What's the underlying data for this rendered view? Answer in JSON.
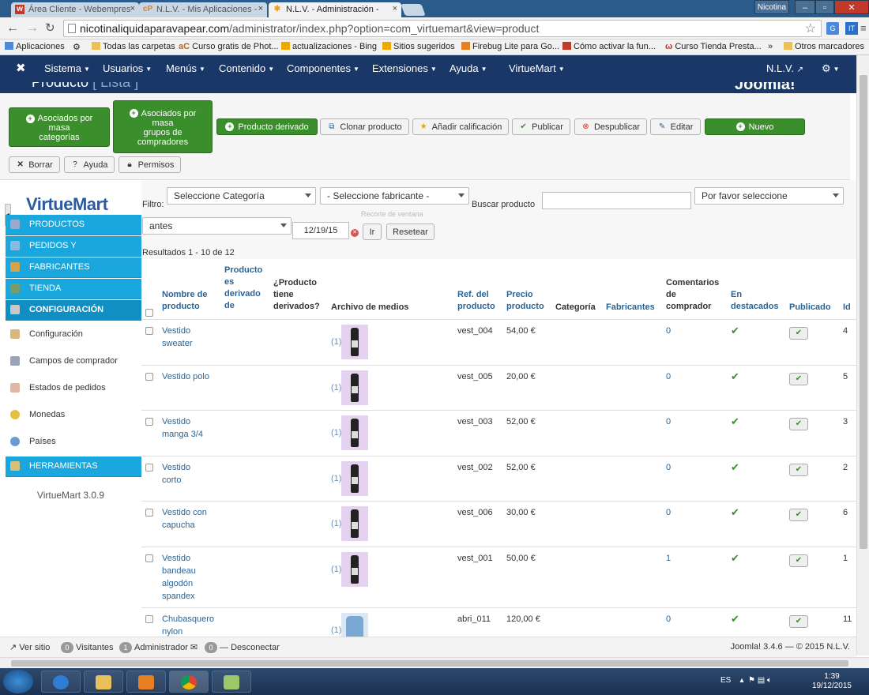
{
  "browser": {
    "tabs": [
      {
        "label": "Área Cliente - Webempres",
        "active": false
      },
      {
        "label": "N.L.V. - Mis Aplicaciones -",
        "active": false
      },
      {
        "label": "N.L.V. - Administración -",
        "active": true
      }
    ],
    "window_user": "Nicotina",
    "url_host": "nicotinaliquidaparavapear.com",
    "url_path": "/administrator/index.php?option=com_virtuemart&view=product",
    "bookmarks": [
      "Aplicaciones",
      "Todas las carpetas",
      "Curso gratis de Phot...",
      "actualizaciones - Bing",
      "Sitios sugeridos",
      "Firebug Lite para Go...",
      "Cómo activar la fun...",
      "Curso Tienda Presta...",
      "»",
      "Otros marcadores"
    ]
  },
  "joomla_nav": {
    "items": [
      "Sistema",
      "Usuarios",
      "Menús",
      "Contenido",
      "Componentes",
      "Extensiones",
      "Ayuda",
      "VirtueMart"
    ],
    "site_name": "N.L.V.",
    "page_title": "Producto",
    "page_subtitle": "[ Lista ]",
    "logo": "Joomla!"
  },
  "toolbar": {
    "mass_categories": [
      "Asociados por",
      "masa",
      "categorías"
    ],
    "mass_groups": [
      "Asociados por",
      "masa",
      "grupos de",
      "compradores"
    ],
    "derived": "Producto derivado",
    "clone": "Clonar producto",
    "rating": "Añadir calificación",
    "publish": "Publicar",
    "unpublish": "Despublicar",
    "edit": "Editar",
    "new": "Nuevo",
    "delete": "Borrar",
    "help": "Ayuda",
    "permissions": "Permisos"
  },
  "sidebar": {
    "menus": [
      "PRODUCTOS",
      "PEDIDOS Y",
      "FABRICANTES",
      "TIENDA",
      "CONFIGURACIÓN"
    ],
    "config_items": [
      "Configuración",
      "Campos de comprador",
      "Estados de pedidos",
      "Monedas",
      "Países"
    ],
    "tools": "HERRAMIENTAS",
    "version": "VirtueMart 3.0.9",
    "logo": "VirtueMart"
  },
  "filters": {
    "label": "Filtro:",
    "category": "Seleccione Categoría",
    "manufacturer": "- Seleccione fabricante -",
    "search_label": "Buscar producto",
    "search_value": "",
    "please_select": "Por favor seleccione",
    "date_mode": "antes",
    "date": "12/19/15",
    "go": "Ir",
    "reset": "Resetear",
    "hint": "Recorte de ventana",
    "results": "Resultados 1 - 10 de 12"
  },
  "table": {
    "headers": {
      "name": [
        "Nombre de",
        "producto"
      ],
      "derived_of": [
        "Producto",
        "es",
        "derivado",
        "de"
      ],
      "has_derived": [
        "¿Producto",
        "tiene",
        "derivados?"
      ],
      "media": "Archivo de medios",
      "sku": [
        "Ref. del",
        "producto"
      ],
      "price": [
        "Precio",
        "producto"
      ],
      "category": "Categoría",
      "manufacturer": "Fabricantes",
      "reviews": [
        "Comentarios",
        "de",
        "comprador"
      ],
      "featured": [
        "En",
        "destacados"
      ],
      "published": "Publicado",
      "id": "Id"
    },
    "rows": [
      {
        "name": [
          "Vestido",
          "sweater"
        ],
        "media": "(1)",
        "sku": "vest_004",
        "price": "54,00 €",
        "reviews": "0",
        "featured": "✔",
        "id": "4"
      },
      {
        "name": [
          "Vestido polo"
        ],
        "media": "(1)",
        "sku": "vest_005",
        "price": "20,00 €",
        "reviews": "0",
        "featured": "✔",
        "id": "5"
      },
      {
        "name": [
          "Vestido",
          "manga 3/4"
        ],
        "media": "(1)",
        "sku": "vest_003",
        "price": "52,00 €",
        "reviews": "0",
        "featured": "✔",
        "id": "3"
      },
      {
        "name": [
          "Vestido",
          "corto"
        ],
        "media": "(1)",
        "sku": "vest_002",
        "price": "52,00 €",
        "reviews": "0",
        "featured": "✔",
        "id": "2"
      },
      {
        "name": [
          "Vestido con",
          "capucha"
        ],
        "media": "(1)",
        "sku": "vest_006",
        "price": "30,00 €",
        "reviews": "0",
        "featured": "✔",
        "id": "6"
      },
      {
        "name": [
          "Vestido",
          "bandeau",
          "algodón",
          "spandex"
        ],
        "media": "(1)",
        "sku": "vest_001",
        "price": "50,00 €",
        "reviews": "1",
        "featured": "✔",
        "id": "1"
      },
      {
        "name": [
          "Chubasquero",
          "nylon"
        ],
        "media": "(1)",
        "sku": "abri_011",
        "price": "120,00 €",
        "reviews": "0",
        "featured": "✔",
        "id": "11"
      }
    ]
  },
  "status": {
    "view_site": "Ver sitio",
    "visitors_count": "0",
    "visitors": "Visitantes",
    "admin_count": "1",
    "admin": "Administrador",
    "msg_count": "0",
    "logout": "Desconectar",
    "version": "Joomla! 3.4.6 — © 2015 N.L.V."
  },
  "taskbar": {
    "lang": "ES",
    "time": "1:39",
    "date": "19/12/2015"
  }
}
